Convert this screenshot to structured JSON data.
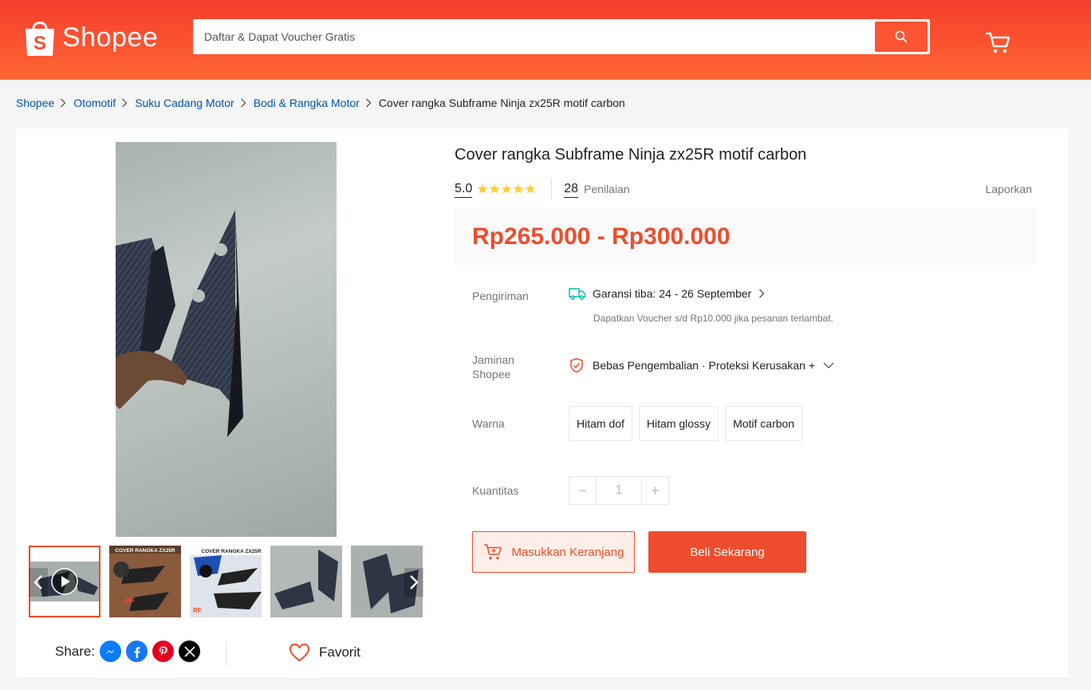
{
  "header": {
    "logo_text": "Shopee",
    "search_placeholder": "Daftar & Dapat Voucher Gratis",
    "brand_color": "#ee4d2d"
  },
  "breadcrumb": {
    "items": [
      "Shopee",
      "Otomotif",
      "Suku Cadang Motor",
      "Bodi & Rangka Motor"
    ],
    "current": "Cover rangka Subframe Ninja zx25R motif carbon"
  },
  "product": {
    "title": "Cover rangka Subframe Ninja zx25R motif carbon",
    "rating": "5.0",
    "stars": 5,
    "review_count": "28",
    "review_label": "Penilaian",
    "report_label": "Laporkan",
    "price": "Rp265.000 - Rp300.000"
  },
  "shipping": {
    "label": "Pengiriman",
    "text": "Garansi tiba: 24 - 26 September",
    "sub": "Dapatkan Voucher s/d Rp10.000 jika pesanan terlambat."
  },
  "guarantee": {
    "label_line1": "Jaminan",
    "label_line2": "Shopee",
    "text": "Bebas Pengembalian · Proteksi Kerusakan +"
  },
  "variants": {
    "label": "Warna",
    "options": [
      "Hitam dof",
      "Hitam glossy",
      "Motif carbon"
    ]
  },
  "quantity": {
    "label": "Kuantitas",
    "value": "1",
    "minus": "−",
    "plus": "+"
  },
  "actions": {
    "add_to_cart": "Masukkan Keranjang",
    "buy_now": "Beli Sekarang"
  },
  "gallery": {
    "thumb1_caption": "",
    "thumb2_caption": "COVER RANGKA ZX25R",
    "thumb3_caption": "COVER RANGKA ZX25R",
    "thumb_brand": "RF"
  },
  "social": {
    "share_label": "Share:",
    "favorite_label": "Favorit",
    "icons": [
      "messenger-icon",
      "facebook-icon",
      "pinterest-icon",
      "x-icon"
    ]
  }
}
